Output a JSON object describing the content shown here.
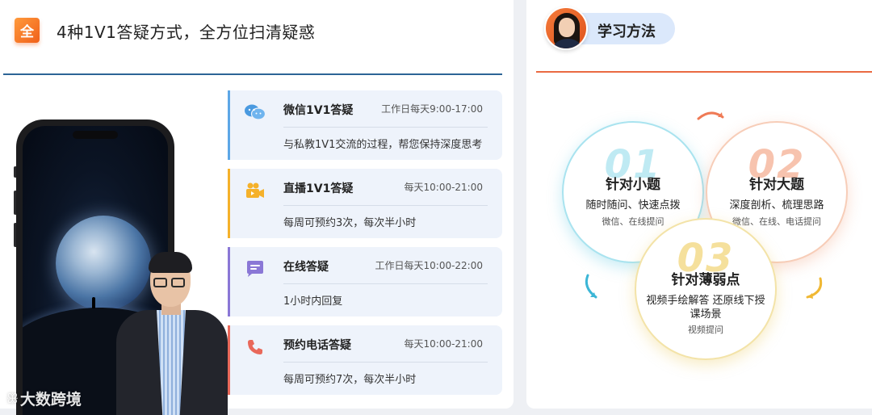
{
  "left": {
    "badge": "全",
    "title": "4种1V1答疑方式，全方位扫清疑惑",
    "watermark": "大数跨境",
    "watermark_logo": "ꕥ"
  },
  "cards": [
    {
      "icon": "wechat-icon",
      "name": "微信1V1答疑",
      "time": "工作日每天9:00-17:00",
      "desc": "与私教1V1交流的过程，帮您保持深度思考",
      "accent": "#5da7e6"
    },
    {
      "icon": "live-video-icon",
      "name": "直播1V1答疑",
      "time": "每天10:00-21:00",
      "desc": "每周可预约3次，每次半小时",
      "accent": "#f5b12a"
    },
    {
      "icon": "chat-message-icon",
      "name": "在线答疑",
      "time": "工作日每天10:00-22:00",
      "desc": "1小时内回复",
      "accent": "#8a77d6"
    },
    {
      "icon": "phone-icon",
      "name": "预约电话答疑",
      "time": "每天10:00-21:00",
      "desc": "每周可预约7次，每次半小时",
      "accent": "#e9685a"
    }
  ],
  "right": {
    "title": "学习方法",
    "circles": [
      {
        "num": "01",
        "title": "针对小题",
        "line": "随时随问、快速点拨",
        "sub": "微信、在线提问"
      },
      {
        "num": "02",
        "title": "针对大题",
        "line": "深度剖析、梳理思路",
        "sub": "微信、在线、电话提问"
      },
      {
        "num": "03",
        "title": "针对薄弱点",
        "line": "视频手绘解答 还原线下授课场景",
        "sub": "视频提问"
      }
    ]
  },
  "colors": {
    "left_divider": "#2d6496",
    "right_divider": "#ea6a42",
    "badge": "#f0601a"
  }
}
